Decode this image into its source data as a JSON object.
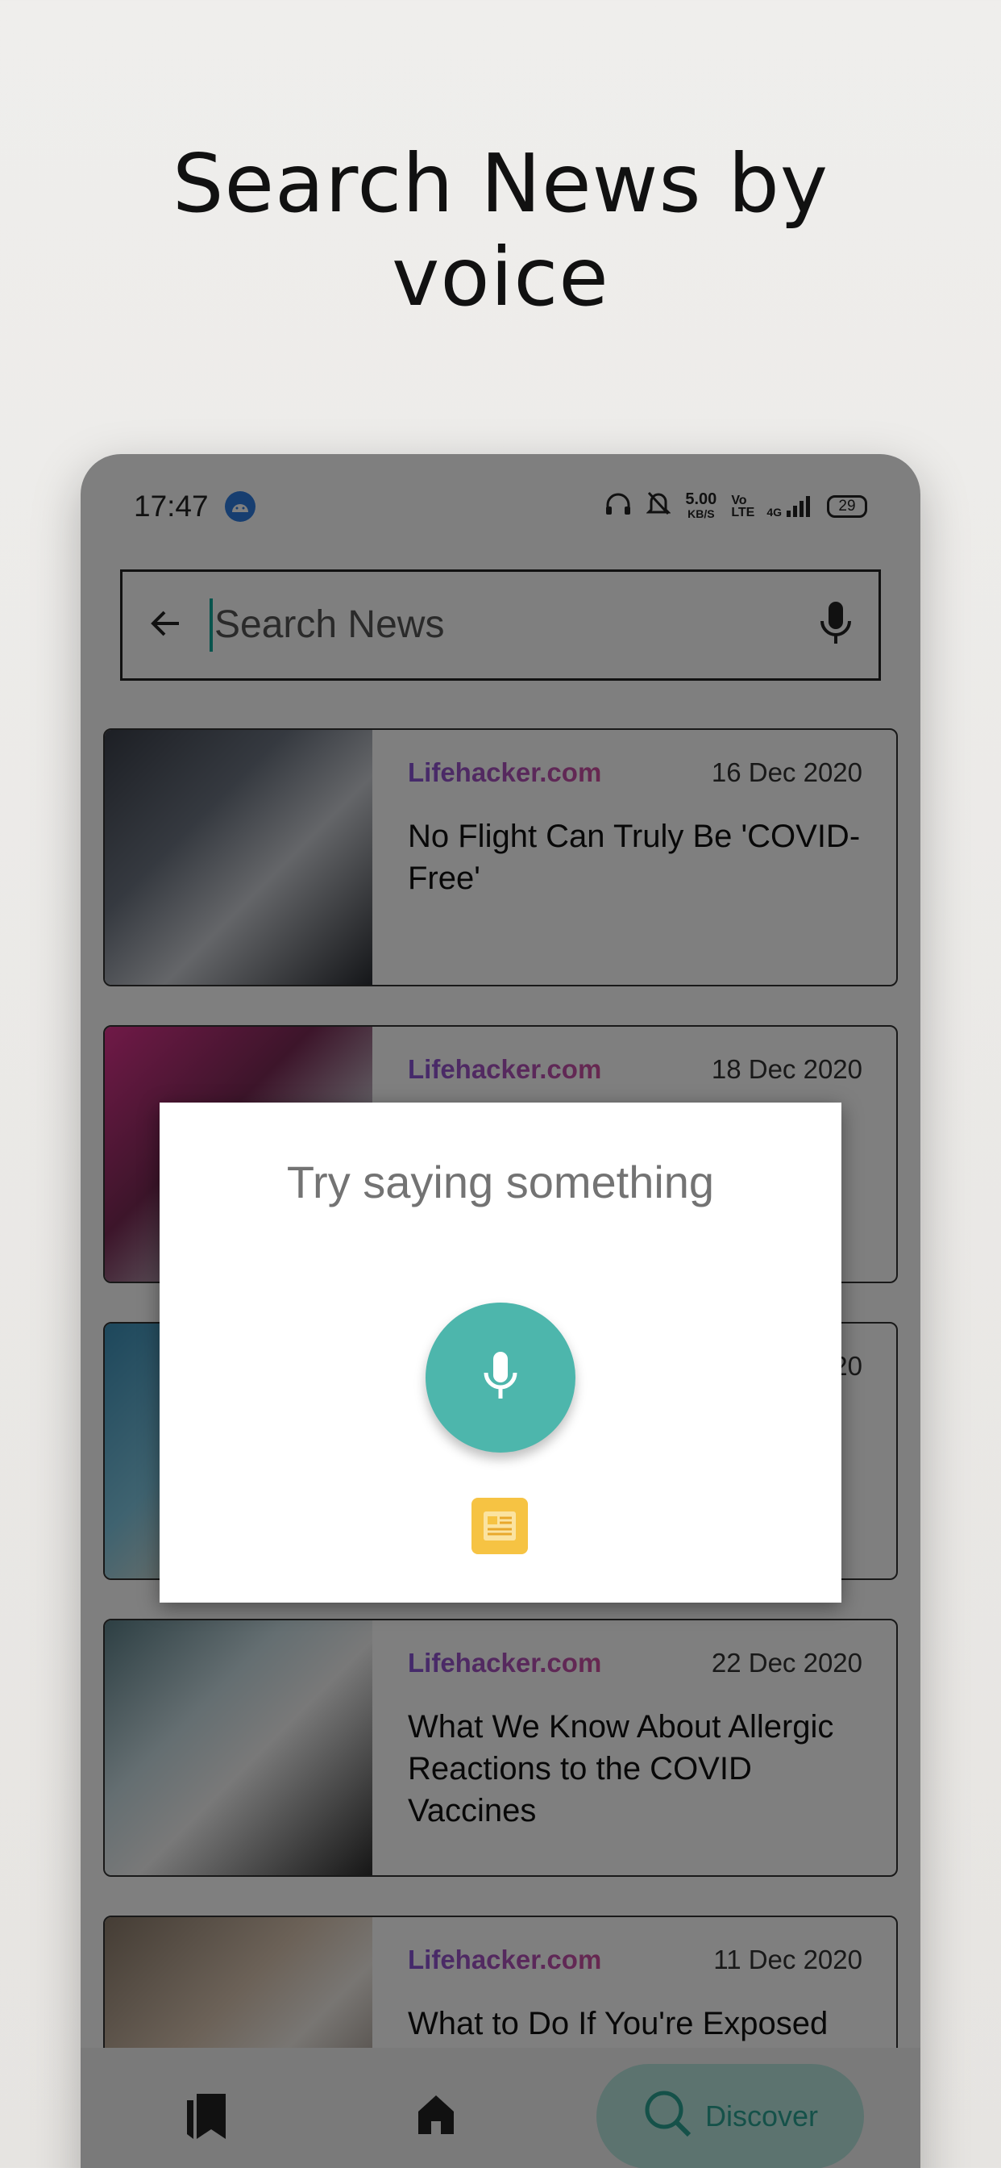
{
  "promo": {
    "headline_line1": "Search News by",
    "headline_line2": "voice"
  },
  "statusbar": {
    "time": "17:47",
    "net_speed_value": "5.00",
    "net_speed_unit": "KB/S",
    "volte": "Vo LTE",
    "network": "4G",
    "battery": "29"
  },
  "search": {
    "placeholder": "Search News"
  },
  "news": [
    {
      "source": "Lifehacker.com",
      "date": "16 Dec 2020",
      "title": "No Flight Can Truly Be 'COVID-Free'"
    },
    {
      "source": "Lifehacker.com",
      "date": "18 Dec 2020",
      "title": ""
    },
    {
      "source": "",
      "date": "20",
      "title": ""
    },
    {
      "source": "Lifehacker.com",
      "date": "22 Dec 2020",
      "title": "What We Know About Allergic Reactions to the COVID Vaccines"
    },
    {
      "source": "Lifehacker.com",
      "date": "11 Dec 2020",
      "title": "What to Do If You're Exposed"
    }
  ],
  "dialog": {
    "prompt": "Try saying something"
  },
  "nav": {
    "discover_label": "Discover"
  },
  "colors": {
    "accent": "#4db6ac",
    "discover_bg": "#b8e6df",
    "logo": "#f6c343"
  },
  "icons": [
    "back-arrow-icon",
    "microphone-icon",
    "bookmarks-icon",
    "home-icon",
    "search-icon",
    "headphones-icon",
    "bell-off-icon",
    "signal-icon",
    "android-icon"
  ]
}
